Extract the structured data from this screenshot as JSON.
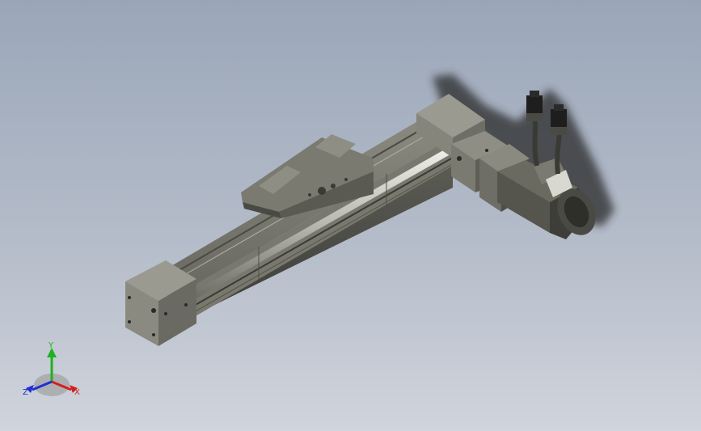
{
  "triad": {
    "x_label": "X",
    "y_label": "Y",
    "z_label": "Z",
    "colors": {
      "x": "#d22020",
      "y": "#20b020",
      "z": "#2030d0"
    }
  },
  "model": {
    "description_icon": "linear-actuator-with-servo-motor"
  }
}
